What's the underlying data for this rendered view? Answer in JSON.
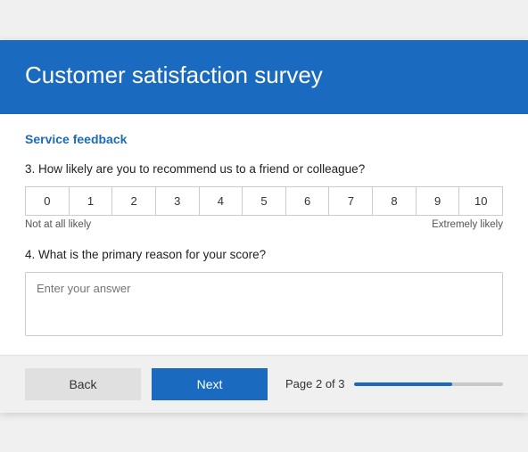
{
  "header": {
    "title": "Customer satisfaction survey"
  },
  "section": {
    "title": "Service feedback"
  },
  "question3": {
    "label": "3. How likely are you to recommend us to a friend or colleague?",
    "scale": [
      "0",
      "1",
      "2",
      "3",
      "4",
      "5",
      "6",
      "7",
      "8",
      "9",
      "10"
    ],
    "low_label": "Not at all likely",
    "high_label": "Extremely likely"
  },
  "question4": {
    "label": "4. What is the primary reason for your score?",
    "placeholder": "Enter your answer"
  },
  "footer": {
    "back_label": "Back",
    "next_label": "Next",
    "page_label": "Page 2 of 3",
    "progress_percent": 66
  }
}
